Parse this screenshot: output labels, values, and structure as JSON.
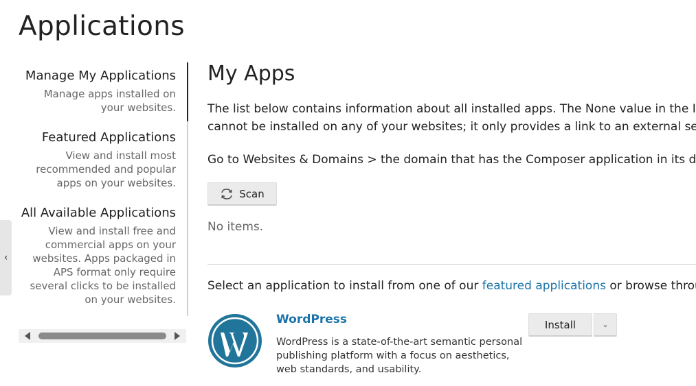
{
  "page": {
    "title": "Applications"
  },
  "sidebar": {
    "collapse_icon": "chevron-left-icon",
    "collapse_glyph": "‹",
    "items": [
      {
        "title": "Manage My Applications",
        "desc_lines": [
          "Manage apps installed on",
          "your websites."
        ]
      },
      {
        "title": "Featured Applications",
        "desc_lines": [
          "View and install most",
          "recommended and popular",
          "apps on your websites."
        ]
      },
      {
        "title": "All Available Applications",
        "desc_lines": [
          "View and install free and",
          "commercial apps on your",
          "websites. Apps packaged in",
          "APS format only require",
          "several clicks to be installed",
          "on your websites."
        ]
      }
    ]
  },
  "main": {
    "title": "My Apps",
    "intro_lines": [
      "The list below contains information about all installed apps. The None value in the Insta",
      "cannot be installed on any of your websites; it only provides a link to an external service"
    ],
    "hint": "Go to Websites & Domains > the domain that has the Composer application in its docur",
    "scan_label": "Scan",
    "scan_icon": "refresh-icon",
    "no_items": "No items.",
    "select_prefix": "Select an application to install from one of our ",
    "select_link": "featured applications",
    "select_suffix": " or browse through"
  },
  "featured_app": {
    "name": "WordPress",
    "logo_icon": "wordpress-logo",
    "description": "WordPress is a state-of-the-art semantic personal publishing platform with a focus on aesthetics, web standards, and usability.",
    "install_label": "Install",
    "menu_glyph": "⌄"
  },
  "colors": {
    "link": "#1a73a8",
    "wordpress_blue": "#21759b",
    "button_bg": "#ebebeb"
  }
}
